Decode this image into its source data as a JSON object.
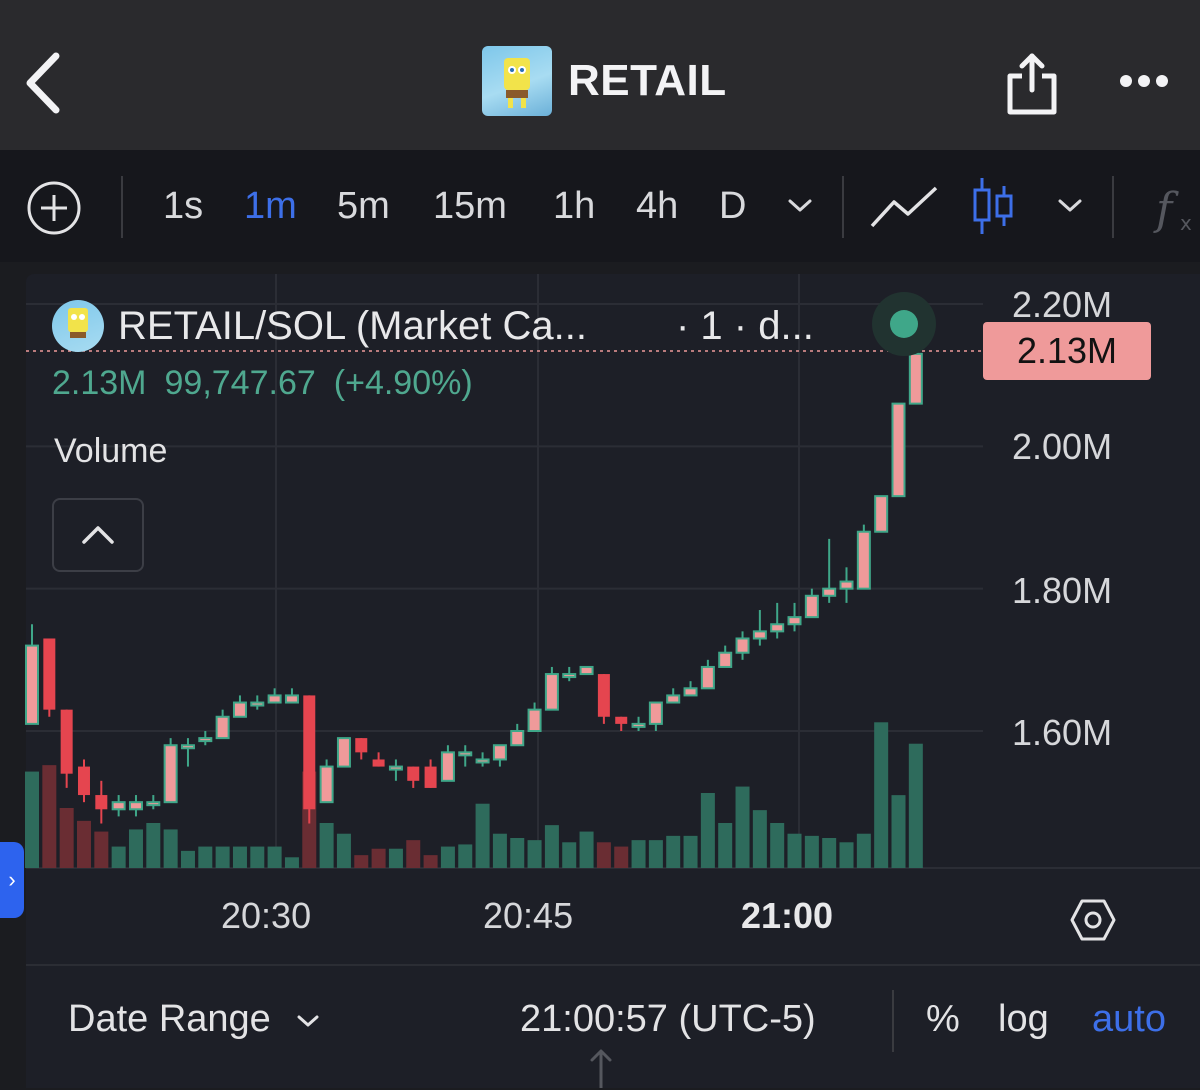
{
  "header": {
    "title": "RETAIL"
  },
  "toolbar": {
    "intervals": [
      "1s",
      "1m",
      "5m",
      "15m",
      "1h",
      "4h",
      "D"
    ],
    "active_interval": "1m"
  },
  "legend": {
    "pair": "RETAIL/SOL (Market Ca...",
    "extra": "· 1 · d...",
    "ohlc": {
      "value": "2.13M",
      "change": "99,747.67",
      "pct": "(+4.90%)"
    },
    "volume_label": "Volume"
  },
  "price_axis": {
    "labels": [
      "2.20M",
      "2.00M",
      "1.80M",
      "1.60M"
    ],
    "last": "2.13M"
  },
  "time_axis": {
    "labels": [
      "20:30",
      "20:45",
      "21:00"
    ]
  },
  "bottom": {
    "date_range": "Date Range",
    "timestamp": "21:00:57 (UTC-5)",
    "percent": "%",
    "log": "log",
    "auto": "auto"
  },
  "colors": {
    "up": "#ef9a9a",
    "up_border": "#3fa789",
    "down": "#e5454f",
    "vol_up": "#2e6b5c",
    "vol_down": "#6a2d33",
    "accent": "#3d6fe8"
  },
  "chart_data": {
    "type": "candlestick",
    "ylim": [
      1.45,
      2.22
    ],
    "yticks": [
      1.6,
      1.8,
      2.0,
      2.2
    ],
    "xticks": [
      "20:30",
      "20:45",
      "21:00"
    ],
    "candles": [
      [
        1.61,
        1.72,
        1.75,
        1.61
      ],
      [
        1.73,
        1.63,
        1.73,
        1.62
      ],
      [
        1.63,
        1.54,
        1.63,
        1.52
      ],
      [
        1.55,
        1.51,
        1.56,
        1.5
      ],
      [
        1.51,
        1.49,
        1.53,
        1.47
      ],
      [
        1.49,
        1.5,
        1.51,
        1.48
      ],
      [
        1.49,
        1.5,
        1.51,
        1.48
      ],
      [
        1.5,
        1.5,
        1.51,
        1.49
      ],
      [
        1.5,
        1.58,
        1.59,
        1.5
      ],
      [
        1.58,
        1.58,
        1.59,
        1.55
      ],
      [
        1.59,
        1.59,
        1.6,
        1.58
      ],
      [
        1.59,
        1.62,
        1.63,
        1.59
      ],
      [
        1.62,
        1.64,
        1.65,
        1.62
      ],
      [
        1.64,
        1.64,
        1.65,
        1.63
      ],
      [
        1.64,
        1.65,
        1.66,
        1.64
      ],
      [
        1.64,
        1.65,
        1.66,
        1.64
      ],
      [
        1.65,
        1.49,
        1.65,
        1.47
      ],
      [
        1.5,
        1.55,
        1.56,
        1.5
      ],
      [
        1.55,
        1.59,
        1.59,
        1.55
      ],
      [
        1.59,
        1.57,
        1.59,
        1.56
      ],
      [
        1.56,
        1.55,
        1.57,
        1.55
      ],
      [
        1.55,
        1.55,
        1.56,
        1.53
      ],
      [
        1.55,
        1.53,
        1.55,
        1.52
      ],
      [
        1.55,
        1.52,
        1.56,
        1.52
      ],
      [
        1.53,
        1.57,
        1.58,
        1.53
      ],
      [
        1.57,
        1.57,
        1.58,
        1.55
      ],
      [
        1.56,
        1.56,
        1.57,
        1.55
      ],
      [
        1.56,
        1.58,
        1.58,
        1.55
      ],
      [
        1.58,
        1.6,
        1.61,
        1.58
      ],
      [
        1.6,
        1.63,
        1.64,
        1.6
      ],
      [
        1.63,
        1.68,
        1.69,
        1.63
      ],
      [
        1.68,
        1.68,
        1.69,
        1.67
      ],
      [
        1.68,
        1.69,
        1.69,
        1.68
      ],
      [
        1.68,
        1.62,
        1.68,
        1.61
      ],
      [
        1.62,
        1.61,
        1.62,
        1.6
      ],
      [
        1.61,
        1.61,
        1.62,
        1.6
      ],
      [
        1.61,
        1.64,
        1.64,
        1.6
      ],
      [
        1.64,
        1.65,
        1.66,
        1.64
      ],
      [
        1.65,
        1.66,
        1.67,
        1.65
      ],
      [
        1.66,
        1.69,
        1.7,
        1.66
      ],
      [
        1.69,
        1.71,
        1.72,
        1.69
      ],
      [
        1.71,
        1.73,
        1.74,
        1.7
      ],
      [
        1.73,
        1.74,
        1.77,
        1.72
      ],
      [
        1.74,
        1.75,
        1.78,
        1.73
      ],
      [
        1.75,
        1.76,
        1.78,
        1.74
      ],
      [
        1.76,
        1.79,
        1.8,
        1.76
      ],
      [
        1.79,
        1.8,
        1.87,
        1.78
      ],
      [
        1.8,
        1.81,
        1.83,
        1.78
      ],
      [
        1.8,
        1.88,
        1.89,
        1.8
      ],
      [
        1.88,
        1.93,
        1.93,
        1.88
      ],
      [
        1.93,
        2.06,
        2.06,
        1.93
      ],
      [
        2.06,
        2.13,
        2.15,
        2.06
      ]
    ],
    "volumes": [
      45,
      48,
      28,
      22,
      17,
      10,
      18,
      21,
      18,
      8,
      10,
      10,
      10,
      10,
      10,
      5,
      45,
      21,
      16,
      6,
      9,
      9,
      13,
      6,
      10,
      11,
      30,
      16,
      14,
      13,
      20,
      12,
      17,
      12,
      10,
      13,
      13,
      15,
      15,
      35,
      21,
      38,
      27,
      21,
      16,
      15,
      14,
      12,
      16,
      68,
      34,
      58
    ]
  }
}
